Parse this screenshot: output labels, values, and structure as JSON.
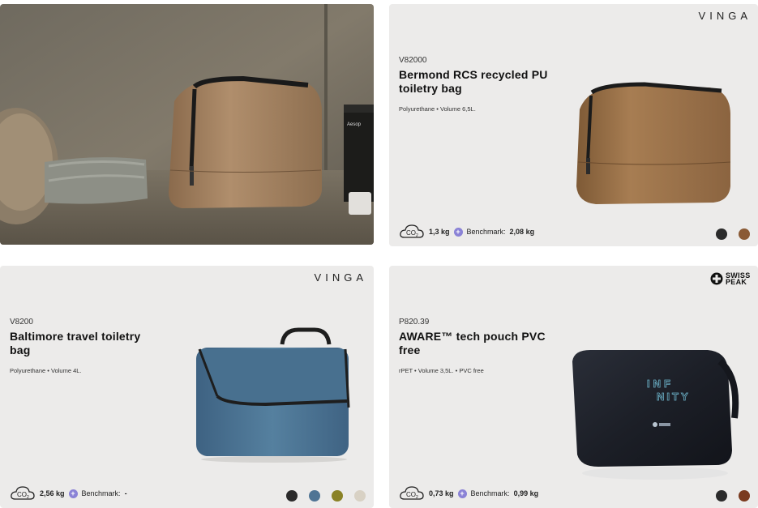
{
  "cards": [
    {
      "brand": "VINGA",
      "sku": "V82000",
      "title": "Bermond RCS recycled PU toiletry bag",
      "specs": "Polyurethane • Volume 6,5L.",
      "co2_label": "CO2",
      "co2_value": "1,3 kg",
      "benchmark_label": "Benchmark:",
      "benchmark_value": "2,08 kg",
      "swatches": [
        "#2b2b2b",
        "#8a5a35"
      ]
    },
    {
      "brand": "VINGA",
      "sku": "V8200",
      "title": "Baltimore travel toiletry bag",
      "specs": "Polyurethane • Volume 4L.",
      "co2_label": "CO2",
      "co2_value": "2,56 kg",
      "benchmark_label": "Benchmark:",
      "benchmark_value": "-",
      "swatches": [
        "#2b2b2b",
        "#4f7494",
        "#8a8226",
        "#d8d1c4"
      ]
    },
    {
      "brand": "SWISS PEAK",
      "sku": "P820.39",
      "title": "AWARE™ tech pouch PVC free",
      "specs": "rPET • Volume 3,5L. • PVC free",
      "co2_label": "CO2",
      "co2_value": "0,73 kg",
      "benchmark_label": "Benchmark:",
      "benchmark_value": "0,99 kg",
      "swatches": [
        "#2b2b2b",
        "#7a3a1e"
      ]
    }
  ],
  "hero": {
    "jar_label": "Aesop"
  },
  "pouch_print": {
    "line1": "INF",
    "line2": "NITY"
  },
  "icons": {
    "co2": "co2-cloud-icon",
    "plus": "plus-icon",
    "swiss_logo": "swiss-cross-icon"
  },
  "colors": {
    "card_bg": "#ecebea",
    "plus_badge": "#8a82d6"
  }
}
